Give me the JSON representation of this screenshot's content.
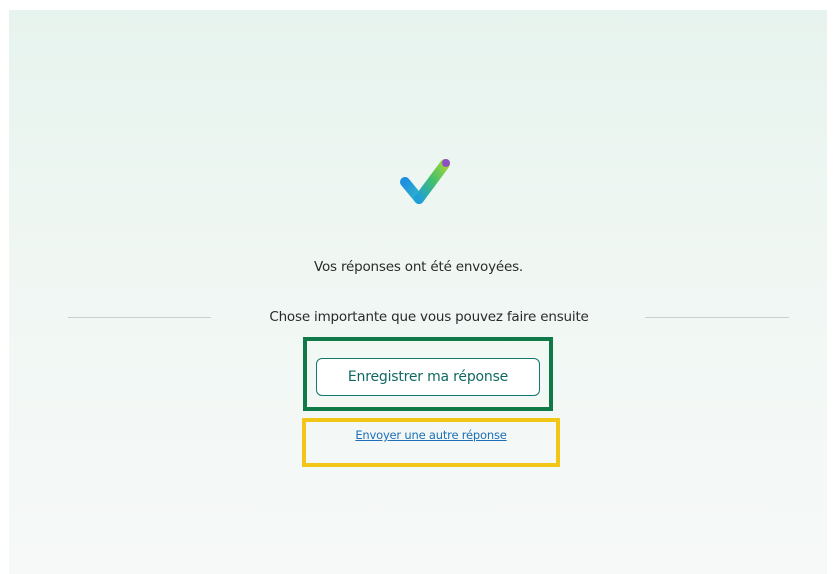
{
  "confirmation": {
    "message": "Vos réponses ont été envoyées.",
    "next_steps_heading": "Chose importante que vous pouvez faire ensuite",
    "save_button_label": "Enregistrer ma réponse",
    "another_response_link": "Envoyer une autre réponse"
  },
  "icons": {
    "success": "checkmark-icon"
  },
  "colors": {
    "background_top": "#e7f3ee",
    "button_border": "#13786f",
    "link": "#1a6fb8",
    "highlight_green": "#0f7a48",
    "highlight_yellow": "#f2c616"
  }
}
